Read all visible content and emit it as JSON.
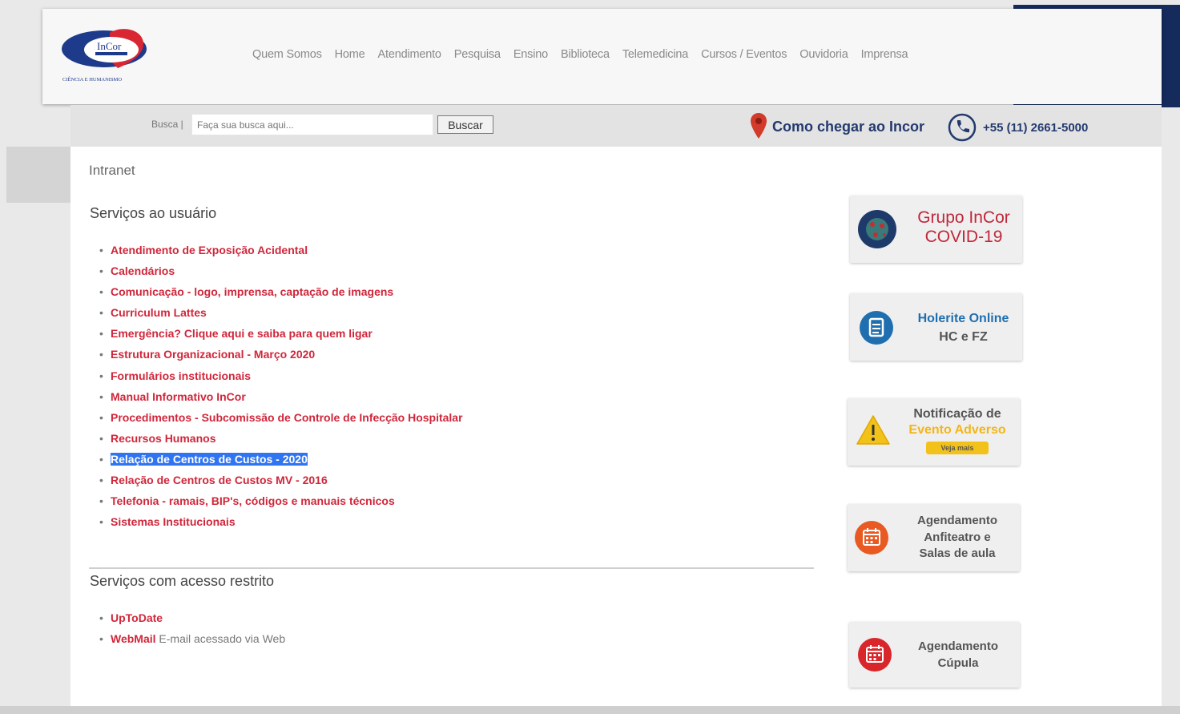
{
  "logo": {
    "text": "InCor",
    "subtitle": "CIÊNCIA E HUMANISMO"
  },
  "nav": {
    "items": [
      "Quem Somos",
      "Home",
      "Atendimento",
      "Pesquisa",
      "Ensino",
      "Biblioteca",
      "Telemedicina",
      "Cursos / Eventos",
      "Ouvidoria",
      "Imprensa"
    ]
  },
  "search": {
    "label": "Busca |",
    "placeholder": "Faça sua busca aqui...",
    "button": "Buscar"
  },
  "contact": {
    "directions": "Como chegar ao Incor",
    "phone": "+55 (11) 2661-5000"
  },
  "breadcrumb": "Intranet",
  "services": {
    "title": "Serviços ao usuário",
    "items": [
      "Atendimento de Exposição Acidental",
      "Calendários",
      "Comunicação - logo, imprensa, captação de imagens",
      "Curriculum Lattes",
      "Emergência? Clique aqui e saiba para quem ligar",
      "Estrutura Organizacional - Março 2020",
      "Formulários institucionais",
      "Manual Informativo InCor",
      "Procedimentos - Subcomissão de Controle de Infecção Hospitalar",
      "Recursos Humanos",
      "Relação de Centros de Custos - 2020",
      "Relação de Centros de Custos MV - 2016",
      "Telefonia - ramais, BIP's, códigos e manuais técnicos",
      "Sistemas Institucionais"
    ]
  },
  "restricted": {
    "title": "Serviços com acesso restrito",
    "items": [
      {
        "label": "UpToDate",
        "desc": ""
      },
      {
        "label": "WebMail",
        "desc": " E-mail acessado via Web"
      }
    ]
  },
  "cards": {
    "covid": {
      "line1": "Grupo InCor",
      "line2": "COVID-19"
    },
    "holerite": {
      "line1": "Holerite Online",
      "line2": "HC e FZ"
    },
    "notificacao": {
      "line1": "Notificação de",
      "line2": "Evento Adverso",
      "badge": "Veja mais"
    },
    "anfiteatro": {
      "line1": "Agendamento",
      "line2": "Anfiteatro e",
      "line3": "Salas de aula"
    },
    "cupula": {
      "line1": "Agendamento",
      "line2": "Cúpula"
    }
  },
  "colors": {
    "link_red": "#d0263a",
    "navy": "#233a6e",
    "highlight": "#2f74f0"
  }
}
